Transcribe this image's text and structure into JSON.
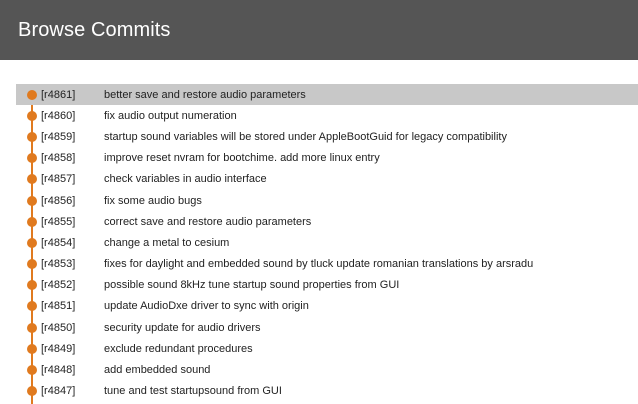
{
  "header": {
    "title": "Browse Commits",
    "background": "#555555",
    "text_color": "#ffffff"
  },
  "timeline": {
    "color": "#e07a1f",
    "selected_row_color": "#c8c8c8"
  },
  "commits": [
    {
      "rev": "[r4861]",
      "message": "better save and restore audio parameters",
      "selected": true
    },
    {
      "rev": "[r4860]",
      "message": "fix audio output numeration",
      "selected": false
    },
    {
      "rev": "[r4859]",
      "message": "startup sound variables will be stored under AppleBootGuid for legacy compatibility",
      "selected": false
    },
    {
      "rev": "[r4858]",
      "message": "improve reset nvram for bootchime. add more linux entry",
      "selected": false
    },
    {
      "rev": "[r4857]",
      "message": "check variables in audio interface",
      "selected": false
    },
    {
      "rev": "[r4856]",
      "message": "fix some audio bugs",
      "selected": false
    },
    {
      "rev": "[r4855]",
      "message": "correct save and restore audio parameters",
      "selected": false
    },
    {
      "rev": "[r4854]",
      "message": "change a metal to cesium",
      "selected": false
    },
    {
      "rev": "[r4853]",
      "message": "fixes for daylight and embedded sound by tluck update romanian translations by arsradu",
      "selected": false
    },
    {
      "rev": "[r4852]",
      "message": "possible sound 8kHz tune startup sound properties from GUI",
      "selected": false
    },
    {
      "rev": "[r4851]",
      "message": "update AudioDxe driver to sync with origin",
      "selected": false
    },
    {
      "rev": "[r4850]",
      "message": "security update for audio drivers",
      "selected": false
    },
    {
      "rev": "[r4849]",
      "message": "exclude redundant procedures",
      "selected": false
    },
    {
      "rev": "[r4848]",
      "message": "add embedded sound",
      "selected": false
    },
    {
      "rev": "[r4847]",
      "message": "tune and test startupsound from GUI",
      "selected": false
    }
  ]
}
